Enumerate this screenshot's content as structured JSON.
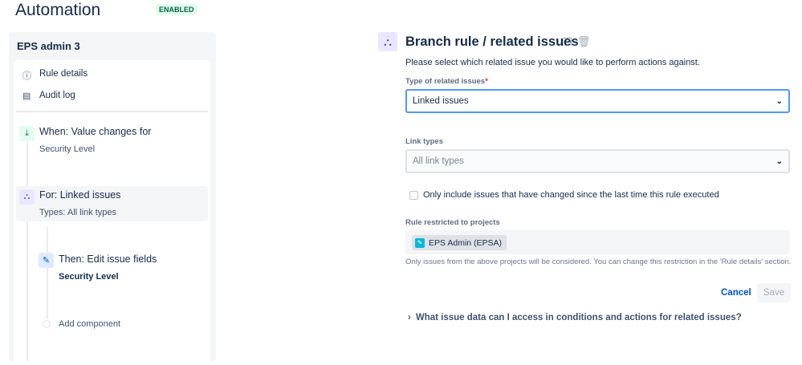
{
  "header": {
    "title": "Automation",
    "status": "ENABLED"
  },
  "sidebar": {
    "rule_name": "EPS admin 3",
    "nav": [
      {
        "label": "Rule details",
        "icon": "info-icon"
      },
      {
        "label": "Audit log",
        "icon": "document-icon"
      }
    ],
    "steps": {
      "trigger": {
        "title": "When: Value changes for",
        "detail": "Security Level"
      },
      "branch": {
        "title": "For: Linked issues",
        "detail": "Types: All link types"
      },
      "action": {
        "title": "Then: Edit issue fields",
        "detail": "Security Level"
      },
      "add": "Add component"
    }
  },
  "panel": {
    "title": "Branch rule / related issues",
    "description": "Please select which related issue you would like to perform actions against.",
    "type_label": "Type of related issues",
    "required": "*",
    "type_value": "Linked issues",
    "link_types_label": "Link types",
    "link_types_placeholder": "All link types",
    "checkbox_label": "Only include issues that have changed since the last time this rule executed",
    "projects_label": "Rule restricted to projects",
    "project": "EPS Admin (EPSA)",
    "projects_help": "Only issues from the above projects will be considered. You can change this restriction in the 'Rule details' section.",
    "cancel": "Cancel",
    "save": "Save",
    "faq": "What issue data can I access in conditions and actions for related issues?"
  },
  "colors": {
    "accent": "#0052cc",
    "focus": "#4c9aff",
    "enabled_bg": "#e3fcef"
  }
}
